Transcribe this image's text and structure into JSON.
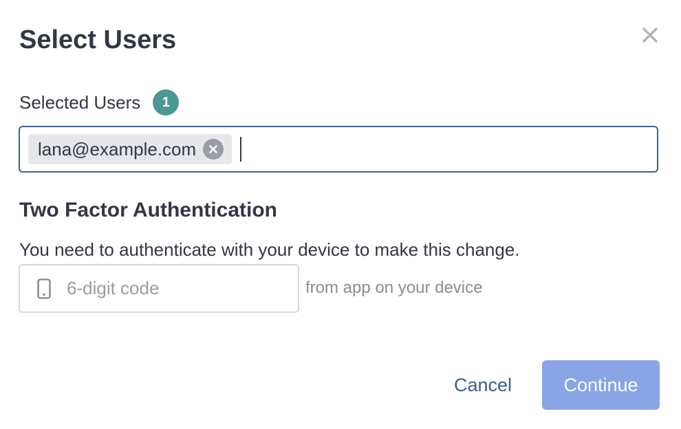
{
  "dialog": {
    "title": "Select Users",
    "close_icon": "close-icon"
  },
  "selected_users": {
    "label": "Selected Users",
    "count": "1",
    "chips": [
      {
        "email": "lana@example.com"
      }
    ]
  },
  "two_factor": {
    "heading": "Two Factor Authentication",
    "description": "You need to authenticate with your device to make this change.",
    "code_placeholder": "6-digit code",
    "code_value": "",
    "hint": "from app on your device",
    "icon": "phone-icon"
  },
  "actions": {
    "cancel_label": "Cancel",
    "continue_label": "Continue"
  },
  "colors": {
    "badge": "#4c9790",
    "input_focus_border": "#3f5f8c",
    "link": "#3d5d8a",
    "primary_disabled": "#89a5e6"
  }
}
